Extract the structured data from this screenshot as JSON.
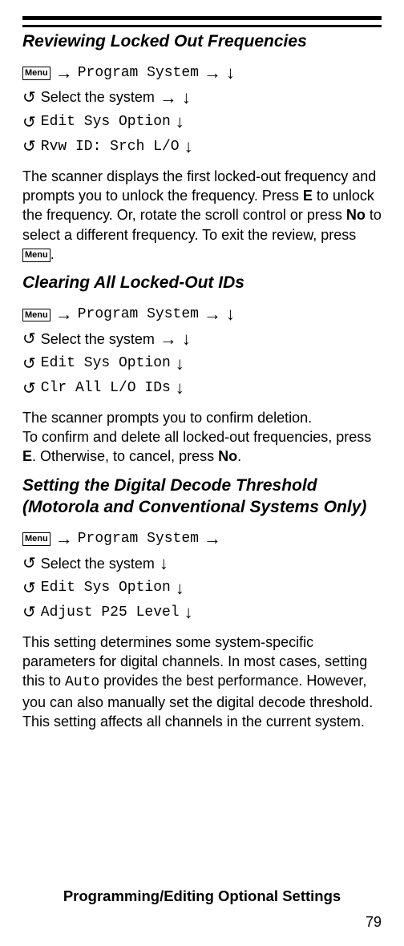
{
  "menuLabel": "Menu",
  "section1": {
    "title": "Reviewing Locked Out Frequencies",
    "nav1": "Program System",
    "nav2": "Select the system",
    "nav3": "Edit Sys Option",
    "nav4": "Rvw ID: Srch L/O",
    "body1": "The scanner displays the first locked-out frequency and prompts you to unlock the frequency. Press ",
    "bold1": "E",
    "body2": " to unlock the frequency. Or, rotate the scroll control or press ",
    "bold2": "No",
    "body3": " to select a different frequency. To exit the review, press ",
    "body4": "."
  },
  "section2": {
    "title": "Clearing All Locked-Out IDs",
    "nav1": "Program System",
    "nav2": "Select the system",
    "nav3": "Edit Sys Option",
    "nav4": "Clr All L/O IDs",
    "body1": "The scanner prompts you to confirm deletion.",
    "body2": "To confirm and delete all locked-out frequencies, press ",
    "bold1": "E",
    "body3": ". Otherwise, to cancel, press ",
    "bold2": "No",
    "body4": "."
  },
  "section3": {
    "title": "Setting the Digital Decode Threshold (Motorola and Conventional Systems Only)",
    "nav1": "Program System",
    "nav2": "Select the system",
    "nav3": "Edit Sys Option",
    "nav4": "Adjust P25 Level",
    "body1": "This setting determines some system-specific parameters for digital channels. In most cases, setting this to ",
    "mono1": "Auto",
    "body2": " provides the best performance. However, you can also manually set the digital decode threshold. This setting affects all channels in the current system."
  },
  "footer": "Programming/Editing Optional Settings",
  "pageNum": "79"
}
